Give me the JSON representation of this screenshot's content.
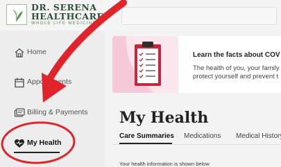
{
  "brand": {
    "line1": "DR. SERENA",
    "line2": "HEALTHCARE",
    "tagline": "WHOLE LIFE MEDICINE"
  },
  "sidebar": {
    "items": [
      {
        "label": "Home",
        "icon": "home-icon"
      },
      {
        "label": "Appointments",
        "icon": "calendar-icon"
      },
      {
        "label": "Billing & Payments",
        "icon": "billing-icon"
      },
      {
        "label": "My Health",
        "icon": "heart-icon",
        "active": true
      }
    ]
  },
  "banner": {
    "title": "Learn the facts about COV",
    "body_line1": "The health of you, your family",
    "body_line2": "protect yourself and prevent t"
  },
  "main": {
    "title": "My Health",
    "tabs": [
      {
        "label": "Care Summaries",
        "active": true
      },
      {
        "label": "Medications"
      },
      {
        "label": "Medical History"
      }
    ],
    "info": "Your health information is shown below"
  },
  "colors": {
    "brand_green": "#2f4f36",
    "accent_red": "#e0242b",
    "sidebar_bg": "#ededed",
    "banner_pink": "#fbe6ee"
  }
}
